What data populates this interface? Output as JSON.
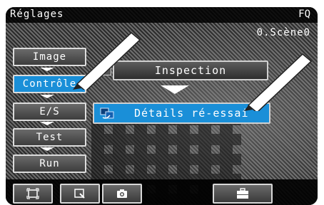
{
  "header": {
    "title": "Réglages",
    "brand": "FQ",
    "scene": "0.Scène0"
  },
  "sidebar": {
    "items": [
      {
        "label": "Image",
        "active": false
      },
      {
        "label": "Contrôle",
        "active": true
      },
      {
        "label": "E/S",
        "active": false
      },
      {
        "label": "Test",
        "active": false
      },
      {
        "label": "Run",
        "active": false
      }
    ]
  },
  "main": {
    "inspection_label": "Inspection",
    "inspection_icon": "document-icon",
    "retry_label": "Détails ré-essai",
    "retry_icon": "retry-details-icon"
  },
  "toolbar": {
    "buttons": [
      {
        "icon": "fit-frame-icon"
      },
      {
        "icon": "zoom-region-icon"
      },
      {
        "icon": "camera-icon"
      },
      {
        "icon": "toolbox-icon"
      }
    ]
  },
  "colors": {
    "accent": "#1a8fd8",
    "button": "#4a4a4a",
    "border": "#d8d8d8"
  }
}
